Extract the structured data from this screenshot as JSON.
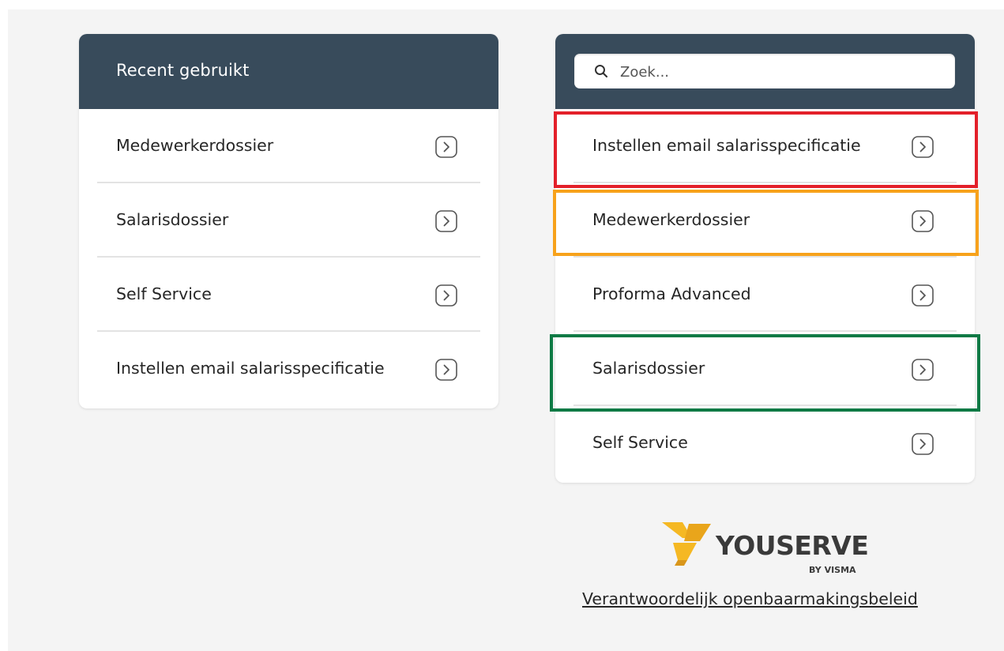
{
  "left_panel": {
    "title": "Recent gebruikt",
    "items": [
      {
        "label": "Medewerkerdossier"
      },
      {
        "label": "Salarisdossier"
      },
      {
        "label": "Self Service"
      },
      {
        "label": "Instellen email salarisspecificatie"
      }
    ]
  },
  "right_panel": {
    "search": {
      "placeholder": "Zoek...",
      "value": ""
    },
    "items": [
      {
        "label": "Instellen email salarisspecificatie"
      },
      {
        "label": "Medewerkerdossier"
      },
      {
        "label": "Proforma Advanced"
      },
      {
        "label": "Salarisdossier"
      },
      {
        "label": "Self Service"
      }
    ]
  },
  "highlights": {
    "red": "#e3202a",
    "orange": "#f7a21b",
    "green": "#0e7a45"
  },
  "logo": {
    "wordmark": "YOUSERVE",
    "byline": "BY VISMA",
    "mark_color": "#f5b823"
  },
  "footer": {
    "link": "Verantwoordelijk openbaarmakingsbeleid"
  },
  "colors": {
    "header_bg": "#384b5b",
    "page_bg": "#f4f4f4"
  },
  "icons": {
    "row_arrow": "chevron-right-box-icon",
    "search": "search-icon"
  }
}
